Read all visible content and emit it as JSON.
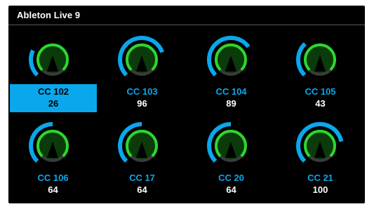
{
  "window": {
    "title": "Ableton Live 9"
  },
  "colors": {
    "background": "#000000",
    "accent": "#0aa7ec",
    "knob_ring": "#2ed62e",
    "knob_fill": "#0b3a0b",
    "knob_track": "#3a3a3a",
    "selected_bg": "#0aa7ec"
  },
  "knobs": [
    {
      "name": "CC 102",
      "value": "26",
      "value_fraction": 0.26,
      "selected": true
    },
    {
      "name": "CC 103",
      "value": "96",
      "value_fraction": 0.76,
      "selected": false
    },
    {
      "name": "CC 104",
      "value": "89",
      "value_fraction": 0.7,
      "selected": false
    },
    {
      "name": "CC 105",
      "value": "43",
      "value_fraction": 0.34,
      "selected": false
    },
    {
      "name": "CC 106",
      "value": "64",
      "value_fraction": 0.5,
      "selected": false
    },
    {
      "name": "CC 17",
      "value": "64",
      "value_fraction": 0.5,
      "selected": false
    },
    {
      "name": "CC 20",
      "value": "64",
      "value_fraction": 0.5,
      "selected": false
    },
    {
      "name": "CC 21",
      "value": "100",
      "value_fraction": 0.79,
      "selected": false
    }
  ]
}
